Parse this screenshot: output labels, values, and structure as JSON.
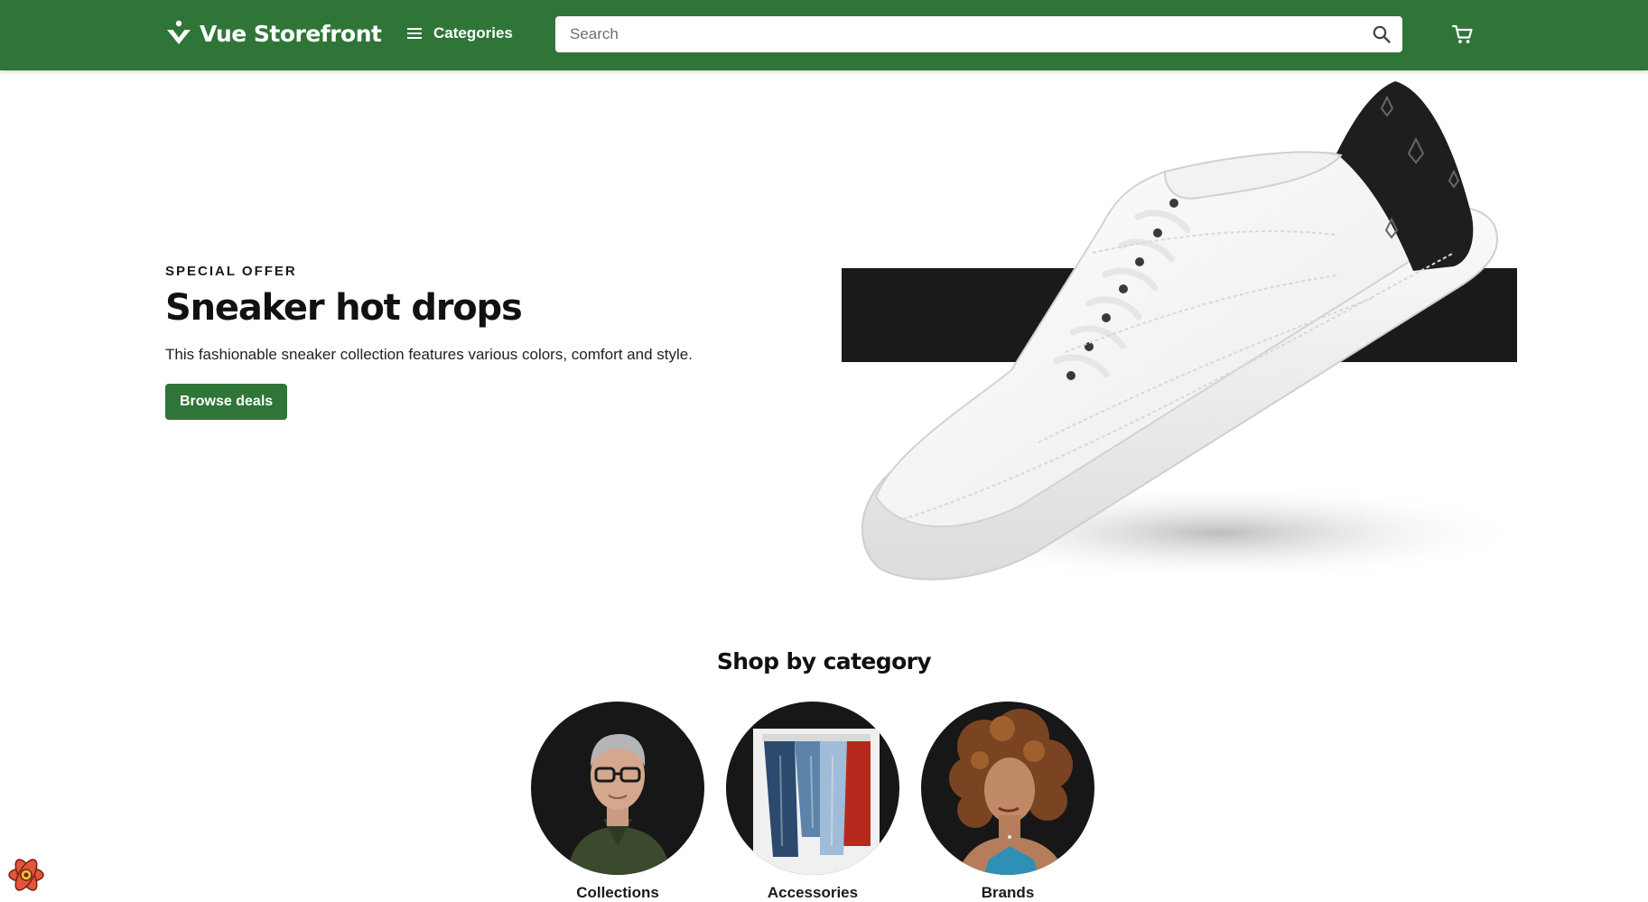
{
  "header": {
    "logo_text": "Vue Storefront",
    "categories_label": "Categories",
    "search": {
      "placeholder": "Search",
      "value": ""
    },
    "cart_icon": "cart-icon",
    "colors": {
      "brand": "#2f7538"
    }
  },
  "hero": {
    "overline": "SPECIAL OFFER",
    "title": "Sneaker hot drops",
    "description": "This fashionable sneaker collection features various colors, comfort and style.",
    "cta_label": "Browse deals"
  },
  "categories": {
    "title": "Shop by category",
    "items": [
      {
        "label": "Collections"
      },
      {
        "label": "Accessories"
      },
      {
        "label": "Brands"
      }
    ]
  }
}
